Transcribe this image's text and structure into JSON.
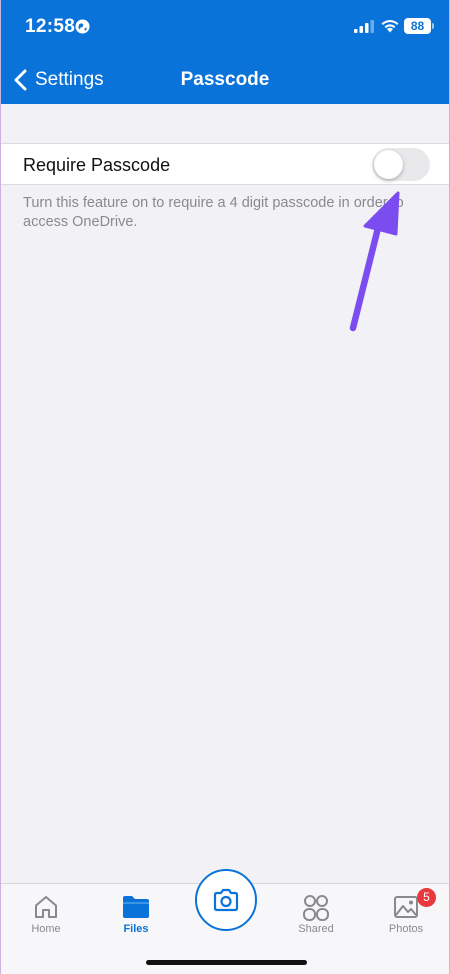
{
  "status_bar": {
    "time": "12:58",
    "battery": "88",
    "icons": [
      "globe-icon",
      "signal-icon",
      "wifi-icon",
      "battery-icon"
    ]
  },
  "nav": {
    "back_label": "Settings",
    "title": "Passcode"
  },
  "setting": {
    "label": "Require Passcode",
    "enabled": false,
    "description": "Turn this feature on to require a 4 digit passcode in order to access OneDrive."
  },
  "tab_bar": {
    "tabs": [
      {
        "label": "Home",
        "icon": "home-icon",
        "active": false
      },
      {
        "label": "Files",
        "icon": "folder-icon",
        "active": true
      },
      {
        "label": "",
        "icon": "camera-icon",
        "active": false
      },
      {
        "label": "Shared",
        "icon": "people-icon",
        "active": false
      },
      {
        "label": "Photos",
        "icon": "photos-icon",
        "active": false,
        "badge": "5"
      }
    ]
  },
  "colors": {
    "accent": "#0a73d9",
    "background": "#f2f1f6",
    "annotation_arrow": "#7b4cf0",
    "badge": "#e8383d"
  }
}
